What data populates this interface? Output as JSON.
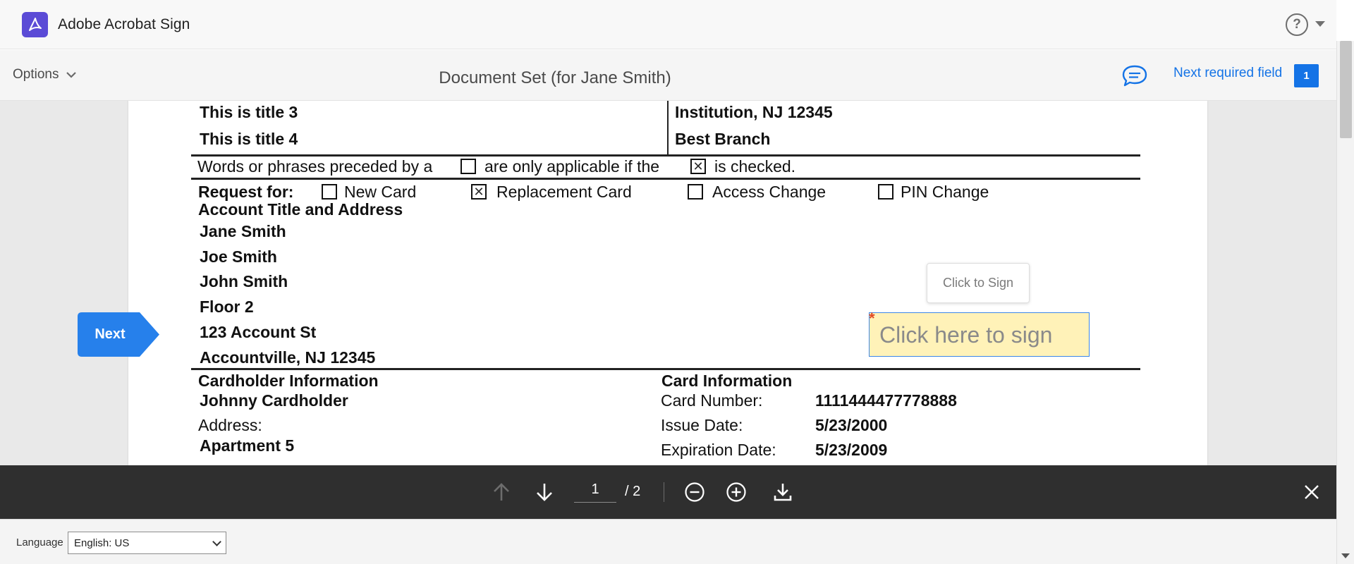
{
  "app": {
    "title": "Adobe Acrobat Sign",
    "brand_color": "#5b4bd6",
    "help_glyph": "?"
  },
  "toolbar": {
    "options_label": "Options",
    "document_title": "Document Set (for Jane Smith)",
    "next_required_label": "Next required field",
    "required_count": "1",
    "accent": "#1473e6"
  },
  "document": {
    "title3": "This is title 3",
    "title4": "This is title 4",
    "institution": "Institution, NJ 12345",
    "branch": "Best Branch",
    "note_part1": "Words or phrases preceded by a",
    "note_part2": "are only applicable if the",
    "note_part3": "is checked.",
    "request_label": "Request for:",
    "request_options": [
      {
        "label": "New Card",
        "checked": false
      },
      {
        "label": "Replacement Card",
        "checked": true
      },
      {
        "label": "Access Change",
        "checked": false
      },
      {
        "label": "PIN Change",
        "checked": false
      }
    ],
    "account_heading": "Account Title and Address",
    "account_lines": [
      "Jane Smith",
      "Joe Smith",
      "John Smith",
      "Floor 2",
      "123 Account St",
      "Accountville, NJ 12345"
    ],
    "cardholder_heading": "Cardholder Information",
    "cardholder_name": "Johnny Cardholder",
    "address_label": "Address:",
    "address_line1": "Apartment 5",
    "card_heading": "Card Information",
    "card_number_label": "Card Number:",
    "card_number": "1111444477778888",
    "issue_date_label": "Issue Date:",
    "issue_date": "5/23/2000",
    "expiration_label": "Expiration Date:",
    "expiration_date": "5/23/2009"
  },
  "signing": {
    "sign_field_text": "Click here to sign",
    "tooltip_text": "Click to Sign",
    "required_marker": "*",
    "next_button_label": "Next"
  },
  "pager": {
    "current_page": "1",
    "total_label": "/ 2"
  },
  "footer": {
    "language_label": "Language",
    "language_value": "English: US"
  }
}
